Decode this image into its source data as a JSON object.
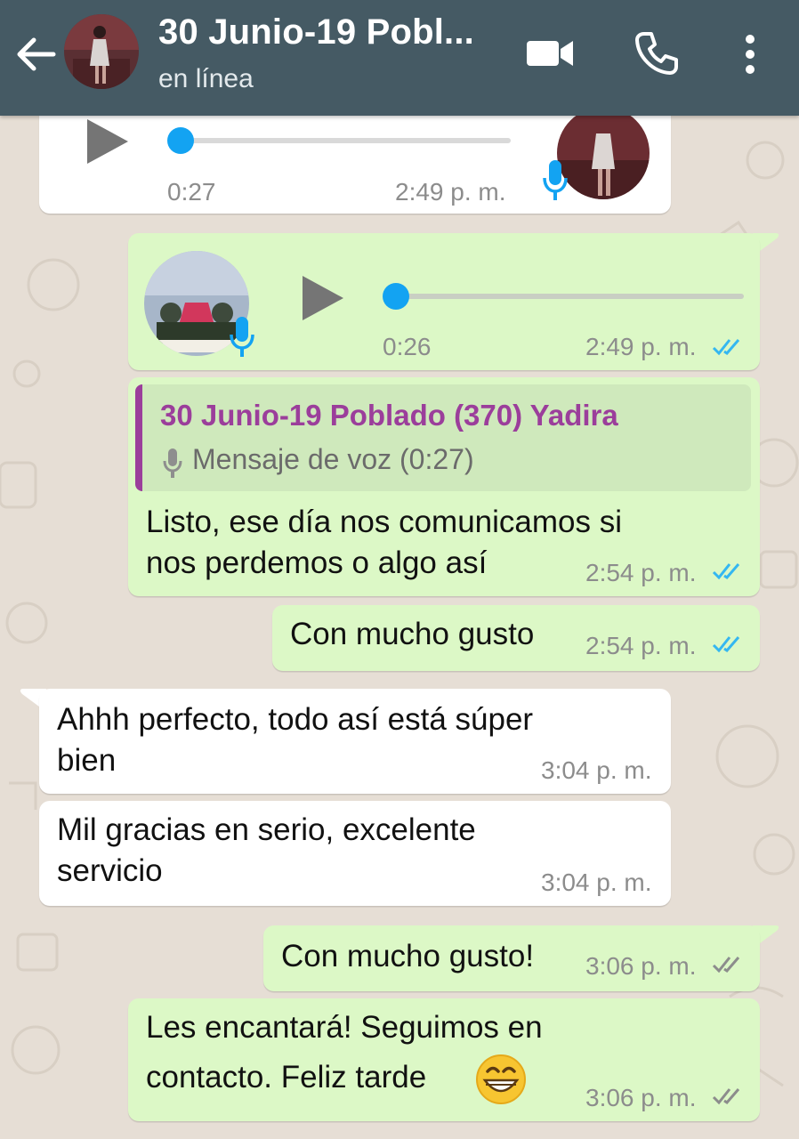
{
  "header": {
    "title": "30 Junio-19 Pobl...",
    "status": "en línea",
    "bar_color": "#455a64"
  },
  "icons": {
    "back": "arrow-left-icon",
    "video": "video-call-icon",
    "phone": "phone-call-icon",
    "more": "more-vert-icon"
  },
  "colors": {
    "incoming_bubble": "#ffffff",
    "outgoing_bubble": "#dcf8c6",
    "read_ticks": "#34b7f1",
    "delivered_ticks": "#8c8c8c",
    "quote_accent": "#9b3e9b",
    "progress_dot": "#13a3f2"
  },
  "messages": [
    {
      "type": "voice",
      "direction": "in",
      "duration": "0:27",
      "time": "2:49 p. m.",
      "progress": 0
    },
    {
      "type": "voice",
      "direction": "out",
      "duration": "0:26",
      "time": "2:49 p. m.",
      "status": "read",
      "progress": 0
    },
    {
      "type": "reply",
      "direction": "out",
      "quote": {
        "author": "30 Junio-19 Poblado (370) Yadira",
        "text": "Mensaje de voz (0:27)"
      },
      "text_line1": "Listo, ese día nos comunicamos si",
      "text_line2": "nos perdemos o algo así",
      "time": "2:54 p. m.",
      "status": "read"
    },
    {
      "type": "text",
      "direction": "out",
      "text": "Con mucho gusto",
      "time": "2:54 p. m.",
      "status": "read"
    },
    {
      "type": "text",
      "direction": "in",
      "text_line1": "Ahhh perfecto, todo así está súper",
      "text_line2": "bien",
      "time": "3:04 p. m."
    },
    {
      "type": "text",
      "direction": "in",
      "text_line1": "Mil gracias en serio, excelente",
      "text_line2": "servicio",
      "time": "3:04 p. m."
    },
    {
      "type": "text",
      "direction": "out",
      "text": "Con mucho gusto!",
      "time": "3:06 p. m.",
      "status": "delivered"
    },
    {
      "type": "text",
      "direction": "out",
      "text_line1": "Les encantará! Seguimos en",
      "text_line2": "contacto. Feliz tarde",
      "emoji": "grinning-face-icon",
      "time": "3:06 p. m.",
      "status": "delivered"
    }
  ]
}
